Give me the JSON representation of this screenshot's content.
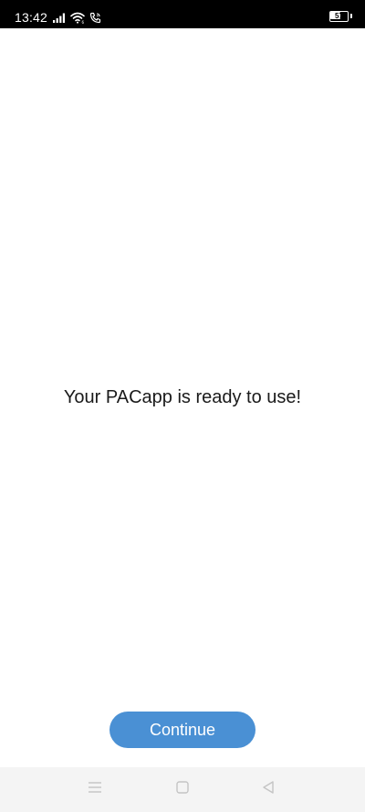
{
  "status_bar": {
    "time": "13:42",
    "battery_level": "57",
    "icons": [
      "signal-icon",
      "wifi-icon",
      "call-icon",
      "battery-icon"
    ]
  },
  "main": {
    "message": "Your PACapp is ready to use!",
    "continue_label": "Continue"
  },
  "nav_bar": {
    "buttons": [
      "menu-icon",
      "home-icon",
      "back-icon"
    ]
  },
  "colors": {
    "button_background": "#4a90d4",
    "status_bar_background": "#000000",
    "nav_bar_background": "#f4f4f4"
  }
}
